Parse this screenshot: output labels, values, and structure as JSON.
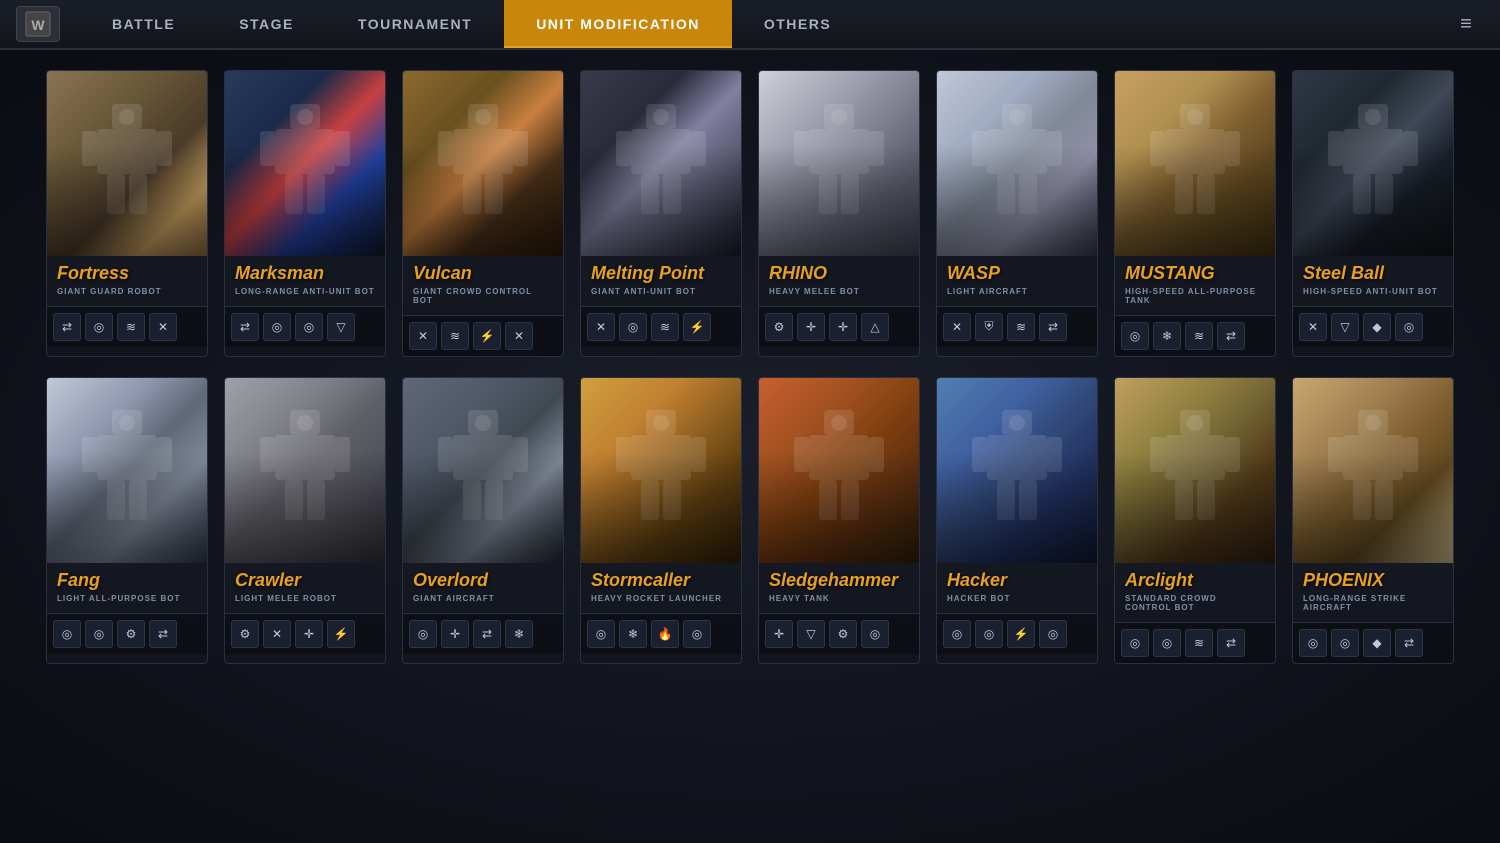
{
  "app": {
    "logo_label": "W"
  },
  "nav": {
    "tabs": [
      {
        "id": "battle",
        "label": "BATTLE",
        "active": false
      },
      {
        "id": "stage",
        "label": "STAGE",
        "active": false
      },
      {
        "id": "tournament",
        "label": "TOURNAMENT",
        "active": false
      },
      {
        "id": "unit-modification",
        "label": "UNIT MODIFICATION",
        "active": true
      },
      {
        "id": "others",
        "label": "otheRS",
        "active": false
      }
    ],
    "menu_icon": "≡"
  },
  "units_row1": [
    {
      "id": "fortress",
      "name": "Fortress",
      "type": "GIANT GUARD ROBOT",
      "img_class": "img-fortress",
      "icons": [
        "⇄",
        "◎",
        "≋",
        "✕"
      ]
    },
    {
      "id": "marksman",
      "name": "Marksman",
      "type": "LONG-RANGE ANTI-UNIT BOT",
      "img_class": "img-marksman",
      "icons": [
        "⇄",
        "◎",
        "◎",
        "▽"
      ]
    },
    {
      "id": "vulcan",
      "name": "Vulcan",
      "type": "GIANT CROWD CONTROL BOT",
      "img_class": "img-vulcan",
      "icons": [
        "✕",
        "≋",
        "⚡",
        "✕"
      ]
    },
    {
      "id": "melting-point",
      "name": "Melting Point",
      "type": "GIANT ANTI-UNIT BOT",
      "img_class": "img-melting",
      "icons": [
        "✕",
        "◎",
        "≋",
        "⚡"
      ]
    },
    {
      "id": "rhino",
      "name": "RHINO",
      "type": "HEAVY MELEE BOT",
      "img_class": "img-rhino",
      "icons": [
        "⚙",
        "✛",
        "✛",
        "△"
      ]
    },
    {
      "id": "wasp",
      "name": "WASP",
      "type": "LIGHT AIRCRAFT",
      "img_class": "img-wasp",
      "icons": [
        "✕",
        "⛨",
        "≋",
        "⇄"
      ]
    },
    {
      "id": "mustang",
      "name": "MUSTANG",
      "type": "HIGH-SPEED ALL-PURPOSE TANK",
      "img_class": "img-mustang",
      "icons": [
        "◎",
        "❄",
        "≋",
        "⇄"
      ]
    },
    {
      "id": "steel-ball",
      "name": "Steel Ball",
      "type": "HIGH-SPEED ANTI-UNIT BOT",
      "img_class": "img-steelball",
      "icons": [
        "✕",
        "▽",
        "◆",
        "◎"
      ]
    }
  ],
  "units_row2": [
    {
      "id": "fang",
      "name": "Fang",
      "type": "LIGHT ALL-PURPOSE BOT",
      "img_class": "img-fang",
      "icons": [
        "◎",
        "◎",
        "⚙",
        "⇄"
      ]
    },
    {
      "id": "crawler",
      "name": "Crawler",
      "type": "LIGHT MELEE ROBOT",
      "img_class": "img-crawler",
      "icons": [
        "⚙",
        "✕",
        "✛",
        "⚡"
      ]
    },
    {
      "id": "overlord",
      "name": "Overlord",
      "type": "GIANT AIRCRAFT",
      "img_class": "img-overlord",
      "icons": [
        "◎",
        "✛",
        "⇄",
        "❄"
      ]
    },
    {
      "id": "stormcaller",
      "name": "Stormcaller",
      "type": "HEAVY ROCKET LAUNCHER",
      "img_class": "img-stormcaller",
      "icons": [
        "◎",
        "❄",
        "🔥",
        "◎"
      ]
    },
    {
      "id": "sledgehammer",
      "name": "Sledgehammer",
      "type": "HEAVY TANK",
      "img_class": "img-sledgehammer",
      "icons": [
        "✛",
        "▽",
        "⚙",
        "◎"
      ]
    },
    {
      "id": "hacker",
      "name": "Hacker",
      "type": "HACKER BOT",
      "img_class": "img-hacker",
      "icons": [
        "◎",
        "◎",
        "⚡",
        "◎"
      ]
    },
    {
      "id": "arclight",
      "name": "Arclight",
      "type": "STANDARD CROWD CONTROL BOT",
      "img_class": "img-arclight",
      "icons": [
        "◎",
        "◎",
        "≋",
        "⇄"
      ]
    },
    {
      "id": "phoenix",
      "name": "PHOENIX",
      "type": "LONG-RANGE STRIKE AIRCRAFT",
      "img_class": "img-phoenix",
      "icons": [
        "◎",
        "◎",
        "◆",
        "⇄"
      ]
    }
  ]
}
